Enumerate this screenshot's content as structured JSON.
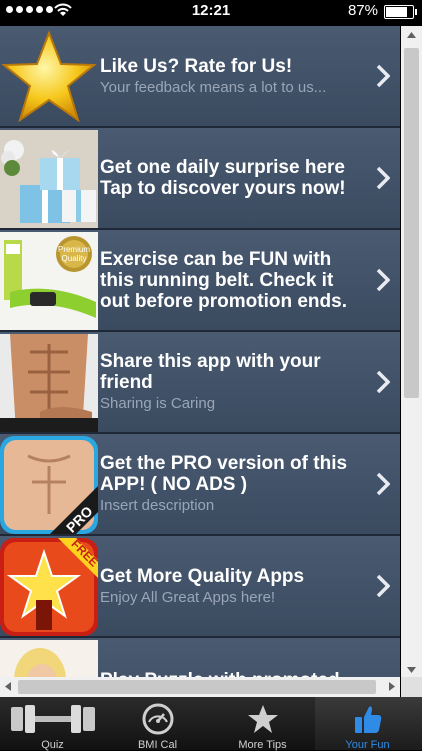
{
  "status_bar": {
    "time": "12:21",
    "battery": "87%",
    "battery_level": 0.87
  },
  "list_items": [
    {
      "title": "Like Us? Rate for Us!",
      "subtitle": "Your feedback means a lot to us...",
      "thumb": "gold-star"
    },
    {
      "title": "Get one daily surprise here Tap to discover yours now!",
      "subtitle": "",
      "thumb": "gift-boxes"
    },
    {
      "title": "Exercise can be FUN with this running belt. Check it out before promotion ends.",
      "subtitle": "",
      "thumb": "running-belt",
      "thumb_badge": "Premium Quality"
    },
    {
      "title": "Share this app with your friend",
      "subtitle": "Sharing is Caring",
      "thumb": "abs-torso"
    },
    {
      "title": "Get the PRO version of this APP! ( NO ADS )",
      "subtitle": "Insert description",
      "thumb": "pro-torso",
      "thumb_badge": "PRO"
    },
    {
      "title": "Get More Quality Apps",
      "subtitle": "Enjoy All Great Apps here!",
      "thumb": "free-star",
      "thumb_badge": "FREE"
    },
    {
      "title": "Play Puzzle with promoted",
      "subtitle": "",
      "thumb": "woman"
    }
  ],
  "tab_bar": {
    "tabs": [
      {
        "label": "Quiz",
        "icon": "dumbbell-icon"
      },
      {
        "label": "BMI Cal",
        "icon": "gauge-icon"
      },
      {
        "label": "More Tips",
        "icon": "star-icon"
      },
      {
        "label": "Your Fun",
        "icon": "thumbs-up-icon",
        "active": true
      }
    ]
  },
  "colors": {
    "list_bg": "#3f4e63",
    "tab_active": "#2f8be6",
    "subtitle": "#9aa6b8"
  }
}
